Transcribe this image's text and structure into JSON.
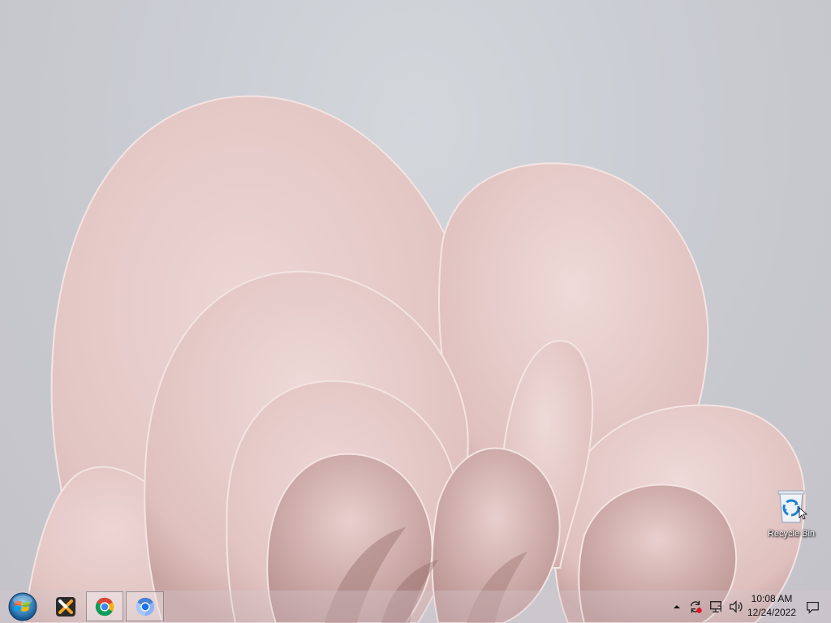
{
  "desktop": {
    "icons": [
      {
        "label": "Recycle Bin",
        "icon": "recycle-bin-icon"
      }
    ]
  },
  "taskbar": {
    "start": {
      "icon": "windows-orb-icon"
    },
    "pinned": [
      {
        "icon": "x-app-icon"
      },
      {
        "icon": "chrome-icon",
        "active": true
      },
      {
        "icon": "chromium-icon",
        "active": true
      }
    ],
    "tray": {
      "overflow_icon": "chevron-up-icon",
      "icons": [
        "sync-icon",
        "network-icon",
        "volume-icon"
      ],
      "time": "10:08 AM",
      "date": "12/24/2022",
      "action_center_icon": "notification-icon"
    }
  },
  "colors": {
    "wallpaper_bg": "#cbcdd2",
    "petal": "#e9cfcd",
    "petal_shadow": "#c9a9a7",
    "taskbar_bg": "#d7c8cd"
  }
}
